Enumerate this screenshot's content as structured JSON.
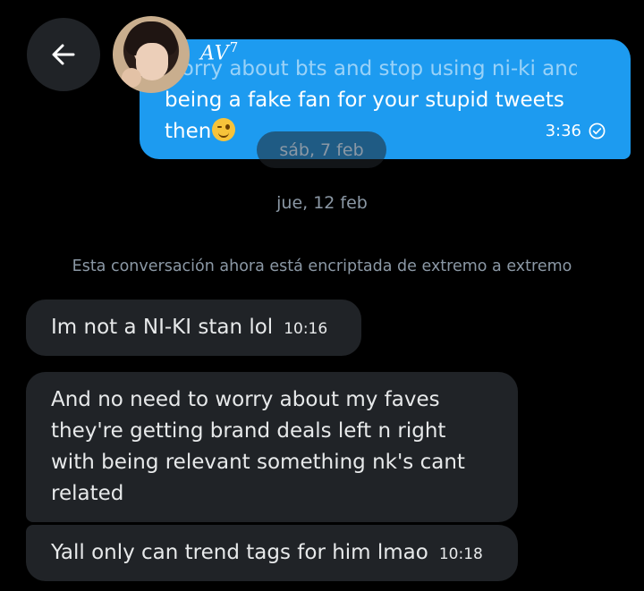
{
  "header": {
    "username": "AV",
    "username_sup": "7"
  },
  "sent_message": {
    "line1": "worry about bts and stop using ni-ki and",
    "line2": "being a fake fan for your stupid tweets",
    "line3": "then",
    "emoji": "winking-face",
    "time": "3:36",
    "status": "read"
  },
  "date_pill": "sáb, 7 feb",
  "date_separator": "jue, 12 feb",
  "encryption_notice": "Esta conversación ahora está encriptada de extremo a extremo",
  "received_messages": [
    {
      "text": "Im not a NI-KI stan lol",
      "time": "10:16"
    },
    {
      "lines": [
        "And no need to worry about my faves",
        "they're getting brand deals left n right",
        "with being relevant something nk's cant",
        "related"
      ]
    },
    {
      "text": "Yall only can trend tags for him lmao",
      "time": "10:18"
    }
  ],
  "colors": {
    "background": "#000000",
    "sent_bubble": "#1d9bf0",
    "received_bubble": "#202327",
    "muted_text": "#8b98a5"
  }
}
